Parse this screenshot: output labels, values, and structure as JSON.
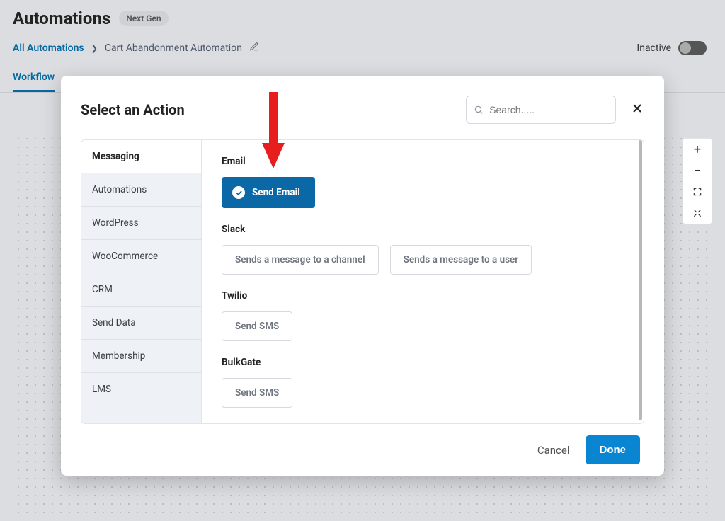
{
  "page": {
    "title": "Automations",
    "badge": "Next Gen"
  },
  "breadcrumb": {
    "root": "All Automations",
    "current": "Cart Abandonment Automation"
  },
  "status": {
    "label": "Inactive"
  },
  "tabs": {
    "workflow": "Workflow"
  },
  "zoom": {
    "in": "+",
    "out": "−"
  },
  "modal": {
    "title": "Select an Action",
    "search_placeholder": "Search.....",
    "categories": [
      "Messaging",
      "Automations",
      "WordPress",
      "WooCommerce",
      "CRM",
      "Send Data",
      "Membership",
      "LMS"
    ],
    "sections": {
      "email": {
        "label": "Email",
        "actions": {
          "send_email": "Send Email"
        }
      },
      "slack": {
        "label": "Slack",
        "actions": {
          "to_channel": "Sends a message to a channel",
          "to_user": "Sends a message to a user"
        }
      },
      "twilio": {
        "label": "Twilio",
        "actions": {
          "send_sms": "Send SMS"
        }
      },
      "bulkgate": {
        "label": "BulkGate",
        "actions": {
          "send_sms": "Send SMS"
        }
      }
    },
    "footer": {
      "cancel": "Cancel",
      "done": "Done"
    }
  },
  "colors": {
    "accent": "#0a85d1",
    "selected": "#0a68a6",
    "annotation": "#e61e1e"
  }
}
